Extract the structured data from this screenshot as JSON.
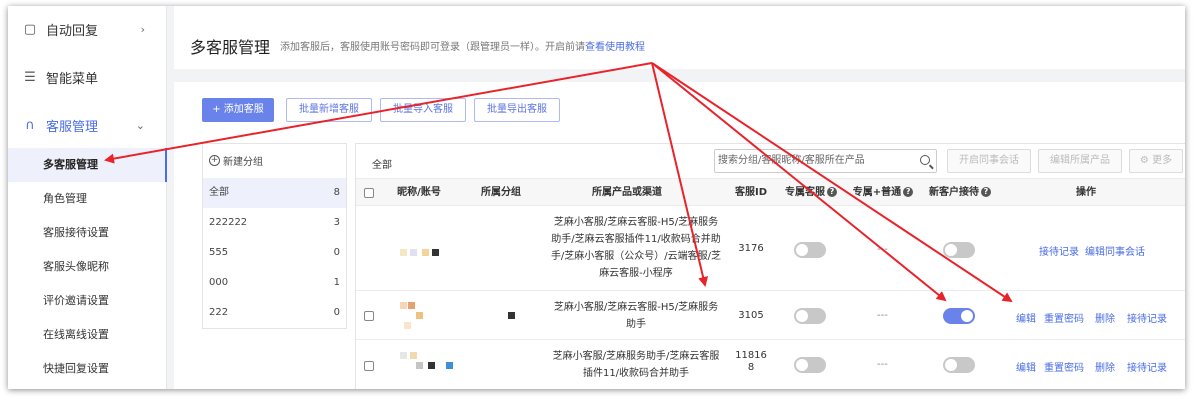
{
  "sidebar": {
    "items": [
      {
        "label": "自动回复",
        "icon": "chat-square-icon",
        "chevron": "›"
      },
      {
        "label": "智能菜单",
        "icon": "menu-list-icon"
      },
      {
        "label": "客服管理",
        "icon": "headset-icon",
        "chevron": "⌄"
      }
    ],
    "sub_items": [
      "多客服管理",
      "角色管理",
      "客服接待设置",
      "客服头像昵称",
      "评价邀请设置",
      "在线离线设置",
      "快捷回复设置"
    ],
    "active_sub_item": "多客服管理"
  },
  "header": {
    "title": "多客服管理",
    "description": "添加客服后，客服使用账号密码即可登录（跟管理员一样）。开启前请",
    "tutorial_link": "查看使用教程"
  },
  "toolbar": {
    "add": "+ 添加客服",
    "batch_add": "批量新增客服",
    "batch_import": "批量导入客服",
    "batch_export": "批量导出客服"
  },
  "groups": {
    "new_group": "新建分组",
    "items": [
      {
        "name": "全部",
        "count": "8"
      },
      {
        "name": "222222",
        "count": "3"
      },
      {
        "name": "555",
        "count": "0"
      },
      {
        "name": "000",
        "count": "1"
      },
      {
        "name": "222",
        "count": "0"
      }
    ]
  },
  "table": {
    "breadcrumb": "全部",
    "search_placeholder": "搜索分组/客服昵称/客服所在产品",
    "actions": {
      "enable_colleague": "开启同事会话",
      "edit_product": "编辑所属产品",
      "more": "更多"
    },
    "columns": {
      "name": "昵称/账号",
      "group": "所属分组",
      "product": "所属产品或渠道",
      "id": "客服ID",
      "exclusive": "专属客服",
      "exclusive_normal": "专属+普通",
      "new_customer": "新客户接待",
      "ops": "操作"
    },
    "rows": [
      {
        "product": [
          "芝麻小客服/芝麻云客服-H5/芝麻服务",
          "助手/芝麻云客服插件11/收款码合并助",
          "手/芝麻小客服（公众号）/云端客服/芝",
          "麻云客服-小程序"
        ],
        "id": [
          "3176"
        ],
        "exclusive_on": false,
        "exclusive_normal": "---",
        "new_customer_on": false,
        "ops": [
          "接待记录",
          "编辑同事会话"
        ]
      },
      {
        "product": [
          "芝麻小客服/芝麻云客服-H5/芝麻服务",
          "助手"
        ],
        "id": [
          "3105"
        ],
        "exclusive_on": false,
        "exclusive_normal": "---",
        "new_customer_on": true,
        "ops": [
          "编辑",
          "重置密码",
          "删除",
          "接待记录"
        ]
      },
      {
        "product": [
          "芝麻小客服/芝麻服务助手/芝麻云客服",
          "插件11/收款码合并助手"
        ],
        "id": [
          "11816",
          "8"
        ],
        "exclusive_on": false,
        "exclusive_normal": "---",
        "new_customer_on": false,
        "ops": [
          "编辑",
          "重置密码",
          "删除",
          "接待记录"
        ]
      }
    ]
  },
  "annotation": {
    "arrow_color": "#e8232a"
  }
}
